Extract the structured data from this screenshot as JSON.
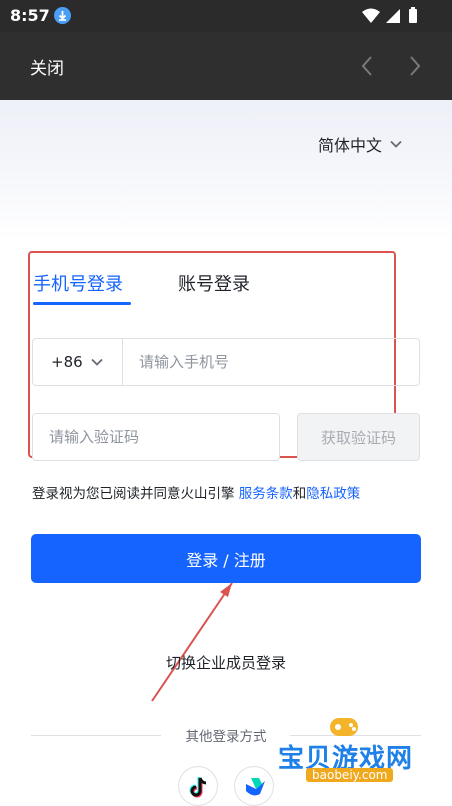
{
  "status_bar": {
    "time": "8:57"
  },
  "nav": {
    "close_label": "关闭"
  },
  "language": {
    "label": "简体中文"
  },
  "tabs": {
    "phone_login": "手机号登录",
    "account_login": "账号登录"
  },
  "phone": {
    "country_code": "+86",
    "placeholder": "请输入手机号"
  },
  "code": {
    "placeholder": "请输入验证码",
    "get_code_label": "获取验证码"
  },
  "agreement": {
    "prefix": "登录视为您已阅读并同意火山引擎 ",
    "terms": "服务条款",
    "and": "和",
    "privacy": "隐私政策"
  },
  "login_button": "登录 / 注册",
  "enterprise_link": "切换企业成员登录",
  "other_methods": "其他登录方式",
  "watermark": {
    "title": "宝贝游戏网",
    "url": "baobeiy.com"
  },
  "colors": {
    "primary": "#1664ff",
    "annotation": "#d9534f",
    "nav_bg": "#2f2f2f"
  }
}
